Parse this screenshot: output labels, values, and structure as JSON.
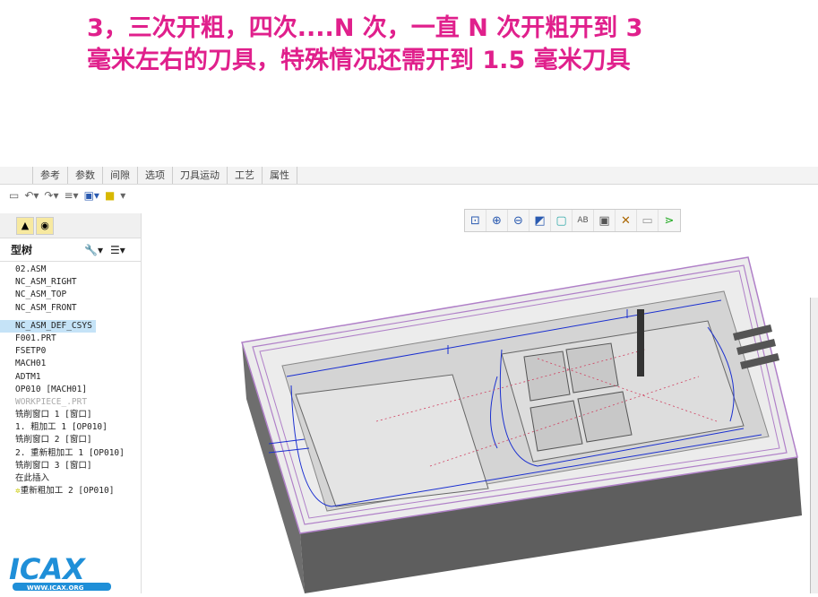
{
  "title": {
    "line1": "3，三次开粗，四次....N 次，一直 N 次开粗开到 3",
    "line2": "毫米左右的刀具，特殊情况还需开到 1.5 毫米刀具"
  },
  "tabs": [
    "参考",
    "参数",
    "间隙",
    "选项",
    "刀具运动",
    "工艺",
    "属性"
  ],
  "sidebar": {
    "header": "型树",
    "tree": [
      "02.ASM",
      "NC_ASM_RIGHT",
      "NC_ASM_TOP",
      "NC_ASM_FRONT",
      "NC_ASM_DEF_CSYS",
      "F001.PRT",
      "FSETP0",
      "MACH01",
      "ADTM1",
      "OP010 [MACH01]",
      "WORKPIECE_.PRT",
      "铣削窗口 1 [窗口]",
      "1. 粗加工 1 [OP010]",
      "铣削窗口 2 [窗口]",
      "2. 重新粗加工 1 [OP010]",
      "铣削窗口 3 [窗口]",
      "在此插入",
      "重新粗加工 2 [OP010]"
    ]
  },
  "logo": {
    "text": "ICAX",
    "url": "WWW.ICAX.ORG"
  },
  "colors": {
    "title": "#e0208c",
    "toolpath": "#1a2fd0",
    "highlight": "#c5e3f7"
  }
}
